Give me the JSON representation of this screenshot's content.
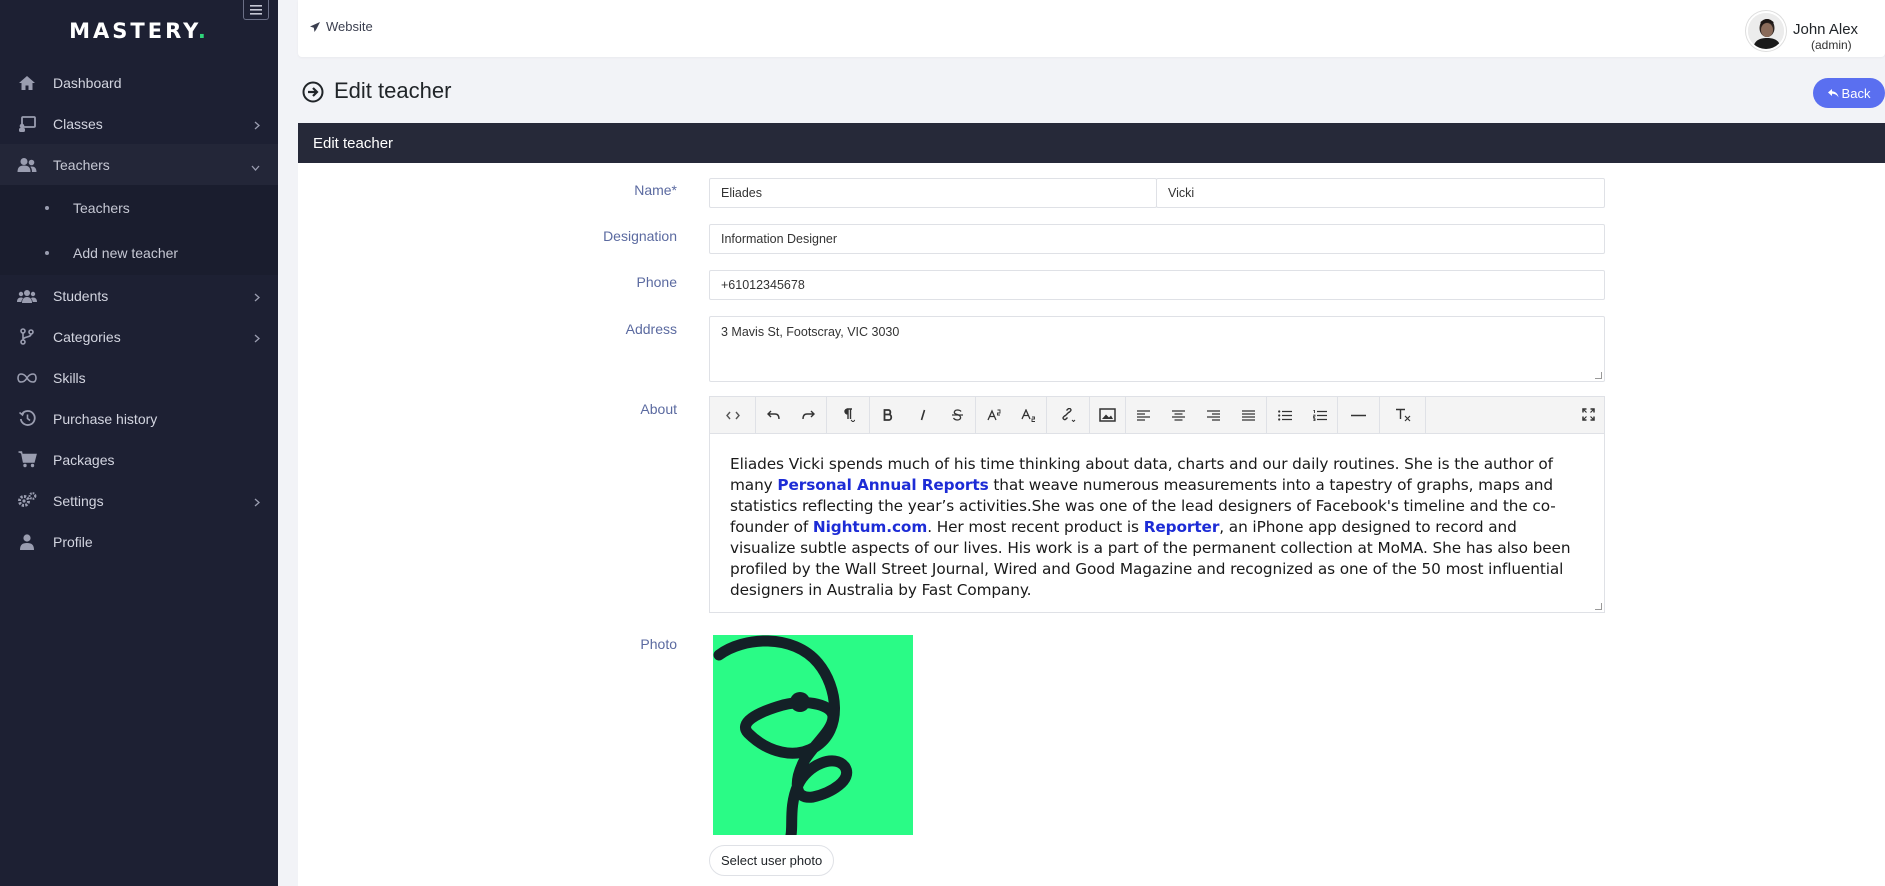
{
  "brand": {
    "name": "MASTERY",
    "dot": ".",
    "dot_color": "#2fd37a"
  },
  "sidebar": {
    "items": [
      {
        "label": "Dashboard",
        "icon": "home-icon"
      },
      {
        "label": "Classes",
        "icon": "chalkboard-icon",
        "has_children": true
      },
      {
        "label": "Teachers",
        "icon": "users-icon",
        "expanded": true,
        "children": [
          {
            "label": "Teachers"
          },
          {
            "label": "Add new teacher"
          }
        ]
      },
      {
        "label": "Students",
        "icon": "user-group-icon",
        "has_children": true
      },
      {
        "label": "Categories",
        "icon": "code-branch-icon",
        "has_children": true
      },
      {
        "label": "Skills",
        "icon": "infinity-icon"
      },
      {
        "label": "Purchase history",
        "icon": "history-icon"
      },
      {
        "label": "Packages",
        "icon": "cart-icon"
      },
      {
        "label": "Settings",
        "icon": "cogs-icon",
        "has_children": true
      },
      {
        "label": "Profile",
        "icon": "user-icon"
      }
    ]
  },
  "header": {
    "website_label": "Website",
    "user": {
      "name": "John Alex",
      "role": "(admin)"
    }
  },
  "page": {
    "title": "Edit teacher",
    "back_label": "Back",
    "accent_color": "#5a6ff0"
  },
  "form": {
    "card_title": "Edit teacher",
    "name_label": "Name*",
    "first_name": "Eliades",
    "last_name": "Vicki",
    "designation_label": "Designation",
    "designation": "Information Designer",
    "phone_label": "Phone",
    "phone": "+61012345678",
    "address_label": "Address",
    "address": "3 Mavis St, Footscray, VIC 3030",
    "about_label": "About",
    "about": {
      "p1": "Eliades Vicki spends much of his time thinking about data, charts and our daily routines. She is the author of many ",
      "link1": "Personal Annual Reports",
      "p2": " that weave numerous measurements into a tapestry of graphs, maps and statistics reflecting the year’s activities.She was one of the lead designers of Facebook's timeline and the co-founder of ",
      "link2": "Nightum.com",
      "p3": ". Her most recent product is ",
      "link3": "Reporter",
      "p4": ", an iPhone app designed to record and visualize subtle aspects of our lives. His work is a part of the permanent collection at MoMA. She has also been profiled by the Wall Street Journal, Wired and Good Magazine and recognized as one of the 50 most influential designers in Australia by Fast Company."
    },
    "photo_label": "Photo",
    "select_photo_label": "Select user photo"
  }
}
